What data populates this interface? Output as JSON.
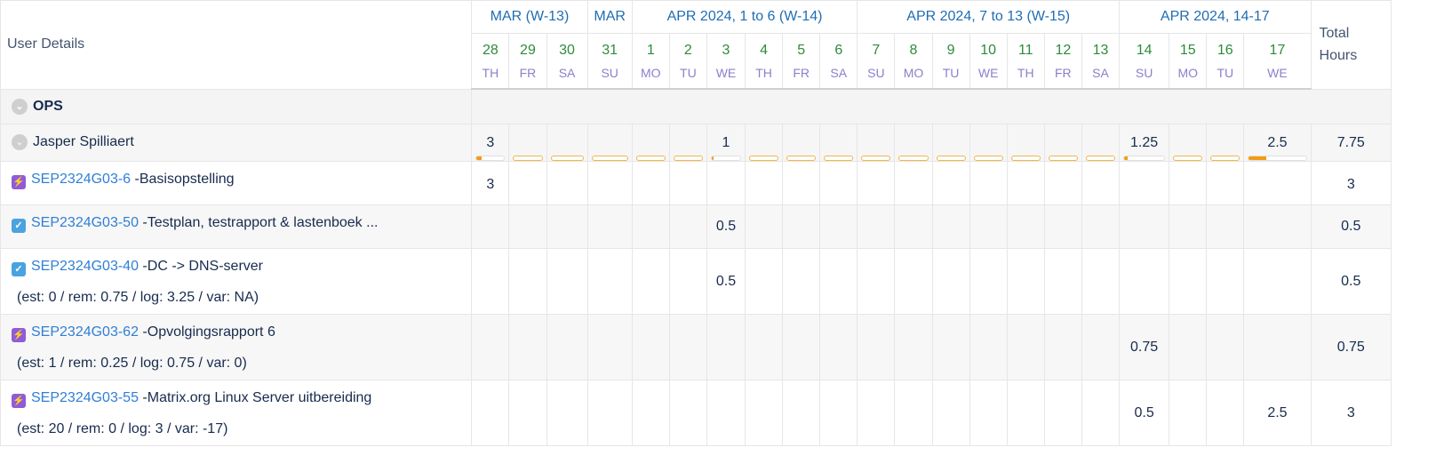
{
  "header": {
    "user_details": "User Details",
    "total_hours_line1": "Total",
    "total_hours_line2": "Hours",
    "weeks": [
      {
        "label": "MAR (W-13)"
      },
      {
        "label": "MAR"
      },
      {
        "label": "APR 2024, 1 to 6 (W-14)"
      },
      {
        "label": "APR 2024, 7 to 13 (W-15)"
      },
      {
        "label": "APR 2024, 14-17"
      }
    ],
    "days": [
      {
        "num": "28",
        "name": "TH"
      },
      {
        "num": "29",
        "name": "FR"
      },
      {
        "num": "30",
        "name": "SA"
      },
      {
        "num": "31",
        "name": "SU"
      },
      {
        "num": "1",
        "name": "MO"
      },
      {
        "num": "2",
        "name": "TU"
      },
      {
        "num": "3",
        "name": "WE"
      },
      {
        "num": "4",
        "name": "TH"
      },
      {
        "num": "5",
        "name": "FR"
      },
      {
        "num": "6",
        "name": "SA"
      },
      {
        "num": "7",
        "name": "SU"
      },
      {
        "num": "8",
        "name": "MO"
      },
      {
        "num": "9",
        "name": "TU"
      },
      {
        "num": "10",
        "name": "WE"
      },
      {
        "num": "11",
        "name": "TH"
      },
      {
        "num": "12",
        "name": "FR"
      },
      {
        "num": "13",
        "name": "SA"
      },
      {
        "num": "14",
        "name": "SU"
      },
      {
        "num": "15",
        "name": "MO"
      },
      {
        "num": "16",
        "name": "TU"
      },
      {
        "num": "17",
        "name": "WE"
      }
    ]
  },
  "group": {
    "name": "OPS",
    "icon": "chevron-down-icon"
  },
  "user": {
    "name": "Jasper Spilliaert",
    "icon": "chevron-down-icon",
    "total": "7.75",
    "days": [
      {
        "value": "3",
        "fill": 0.18
      },
      {
        "value": "",
        "fill": 0
      },
      {
        "value": "",
        "fill": 0
      },
      {
        "value": "",
        "fill": 0
      },
      {
        "value": "",
        "fill": 0
      },
      {
        "value": "",
        "fill": 0
      },
      {
        "value": "1",
        "fill": 0.06
      },
      {
        "value": "",
        "fill": 0
      },
      {
        "value": "",
        "fill": 0
      },
      {
        "value": "",
        "fill": 0
      },
      {
        "value": "",
        "fill": 0
      },
      {
        "value": "",
        "fill": 0
      },
      {
        "value": "",
        "fill": 0
      },
      {
        "value": "",
        "fill": 0
      },
      {
        "value": "",
        "fill": 0
      },
      {
        "value": "",
        "fill": 0
      },
      {
        "value": "",
        "fill": 0
      },
      {
        "value": "1.25",
        "fill": 0.08
      },
      {
        "value": "",
        "fill": 0
      },
      {
        "value": "",
        "fill": 0
      },
      {
        "value": "2.5",
        "fill": 0.3
      }
    ]
  },
  "tasks": [
    {
      "type": "story",
      "key": "SEP2324G03-6",
      "title": " -Basisopstelling",
      "estimate": "",
      "total": "3",
      "cells": [
        "3",
        "",
        "",
        "",
        "",
        "",
        "",
        "",
        "",
        "",
        "",
        "",
        "",
        "",
        "",
        "",
        "",
        "",
        "",
        "",
        ""
      ]
    },
    {
      "type": "task",
      "key": "SEP2324G03-50",
      "title": " -Testplan, testrapport & lastenboek ...",
      "estimate": "",
      "total": "0.5",
      "cells": [
        "",
        "",
        "",
        "",
        "",
        "",
        "0.5",
        "",
        "",
        "",
        "",
        "",
        "",
        "",
        "",
        "",
        "",
        "",
        "",
        "",
        ""
      ]
    },
    {
      "type": "task",
      "key": "SEP2324G03-40",
      "title": " -DC -> DNS-server",
      "estimate": "(est: 0 / rem: 0.75 / log: 3.25 / var: NA)",
      "total": "0.5",
      "cells": [
        "",
        "",
        "",
        "",
        "",
        "",
        "0.5",
        "",
        "",
        "",
        "",
        "",
        "",
        "",
        "",
        "",
        "",
        "",
        "",
        "",
        ""
      ]
    },
    {
      "type": "story",
      "key": "SEP2324G03-62",
      "title": " -Opvolgingsrapport 6",
      "estimate": "(est: 1 / rem: 0.25 / log: 0.75 / var: 0)",
      "total": "0.75",
      "cells": [
        "",
        "",
        "",
        "",
        "",
        "",
        "",
        "",
        "",
        "",
        "",
        "",
        "",
        "",
        "",
        "",
        "",
        "0.75",
        "",
        "",
        ""
      ]
    },
    {
      "type": "story",
      "key": "SEP2324G03-55",
      "title": " -Matrix.org Linux Server uitbereiding",
      "estimate": "(est: 20 / rem: 0 / log: 3 / var: -17)",
      "total": "3",
      "cells": [
        "",
        "",
        "",
        "",
        "",
        "",
        "",
        "",
        "",
        "",
        "",
        "",
        "",
        "",
        "",
        "",
        "",
        "0.5",
        "",
        "",
        "2.5"
      ]
    }
  ],
  "colors": {
    "story": "#8f5bd9",
    "task": "#4aa3df",
    "bar": "#f39c12",
    "link": "#2f7fd6"
  }
}
